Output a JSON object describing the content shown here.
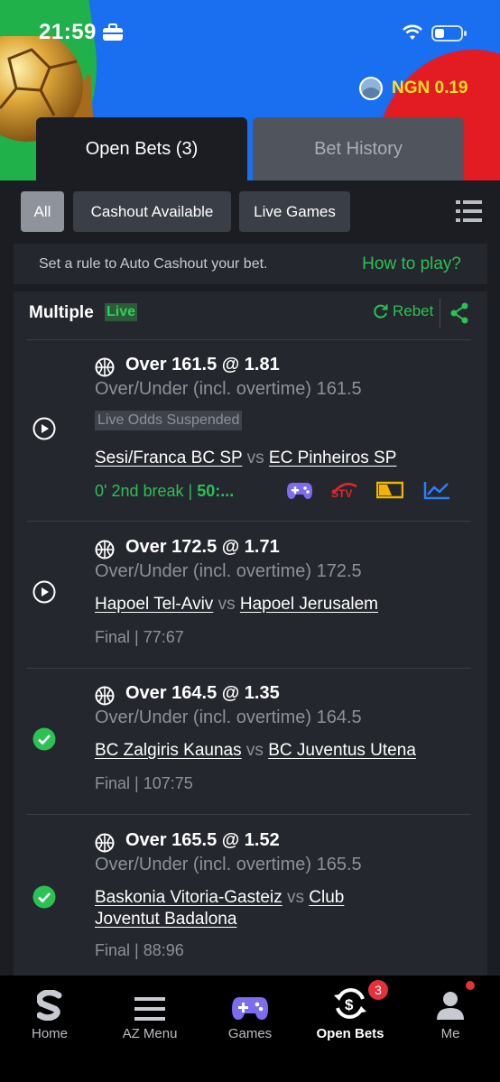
{
  "status_bar": {
    "time": "21:59"
  },
  "balance": {
    "text": "NGN 0.19"
  },
  "tabs": [
    {
      "label": "Open Bets (3)",
      "active": true
    },
    {
      "label": "Bet History",
      "active": false
    }
  ],
  "filters": [
    {
      "label": "All",
      "active": true
    },
    {
      "label": "Cashout Available",
      "active": false
    },
    {
      "label": "Live Games",
      "active": false
    }
  ],
  "auto_cashout": {
    "text": "Set a rule to Auto Cashout your bet.",
    "link": "How to play?"
  },
  "bet": {
    "type": "Multiple",
    "live_badge": "Live",
    "rebet_label": "Rebet",
    "selections": [
      {
        "title": "Over 161.5 @ 1.81",
        "market": "Over/Under (incl. overtime) 161.5",
        "suspended_label": "Live Odds Suspended",
        "home": "Sesi/Franca BC SP",
        "vs": "vs",
        "away": "EC Pinheiros SP",
        "status_prefix": "0' 2nd break | ",
        "status_score": "50:...",
        "state": "live"
      },
      {
        "title": "Over 172.5 @ 1.71",
        "market": "Over/Under (incl. overtime) 172.5",
        "home": "Hapoel Tel-Aviv",
        "vs": "vs",
        "away": "Hapoel Jerusalem",
        "result": "Final | 77:67",
        "state": "pending"
      },
      {
        "title": "Over 164.5 @ 1.35",
        "market": "Over/Under (incl. overtime) 164.5",
        "home": "BC Zalgiris Kaunas",
        "vs": "vs",
        "away": "BC Juventus Utena",
        "result": "Final | 107:75",
        "state": "won"
      },
      {
        "title": "Over 165.5 @ 1.52",
        "market": "Over/Under (incl. overtime) 165.5",
        "home": "Baskonia Vitoria-Gasteiz",
        "vs": "vs",
        "away": "Club Joventut Badalona",
        "result": "Final | 88:96",
        "state": "won"
      }
    ]
  },
  "bottom_nav": [
    {
      "label": "Home",
      "icon": "sportybet-logo-icon"
    },
    {
      "label": "AZ Menu",
      "icon": "hamburger-menu-icon"
    },
    {
      "label": "Games",
      "icon": "gamepad-icon"
    },
    {
      "label": "Open Bets",
      "icon": "open-bets-icon",
      "badge": "3",
      "active": true
    },
    {
      "label": "Me",
      "icon": "user-icon"
    }
  ],
  "colors": {
    "accent_green": "#2bc155",
    "balance_yellow": "#ffe11a",
    "background": "#1b1d22",
    "card": "#24272d"
  }
}
